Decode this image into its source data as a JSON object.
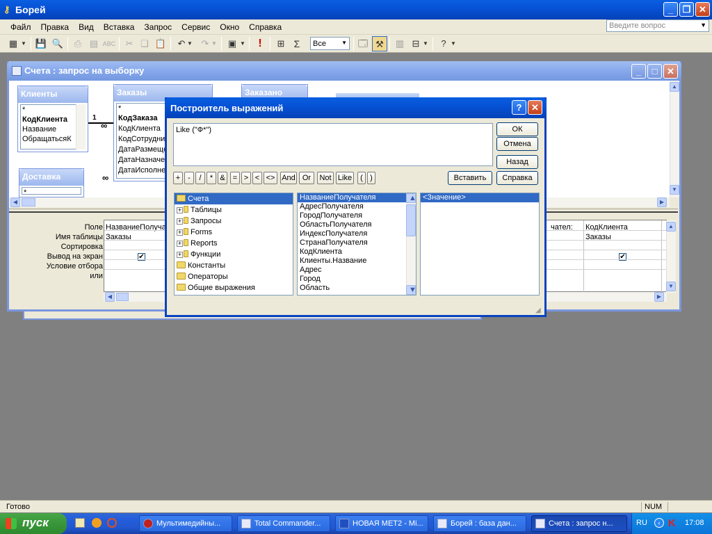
{
  "app": {
    "title": "Борей"
  },
  "menu": [
    "Файл",
    "Правка",
    "Вид",
    "Вставка",
    "Запрос",
    "Сервис",
    "Окно",
    "Справка"
  ],
  "ask_box": {
    "placeholder": "Введите вопрос"
  },
  "toolbar": {
    "top_values": "Все"
  },
  "query_window": {
    "title": "Счета : запрос на выборку",
    "tables": [
      {
        "name": "Клиенты",
        "fields": [
          "*",
          "КодКлиента",
          "Название",
          "ОбращатьсяК"
        ]
      },
      {
        "name": "Заказы",
        "fields": [
          "*",
          "КодЗаказа",
          "КодКлиента",
          "КодСотрудни",
          "ДатаРазмеще",
          "ДатаНазначе",
          "ДатаИсполнен"
        ]
      },
      {
        "name": "Заказано",
        "fields": []
      },
      {
        "name": "Доставка",
        "fields": [
          "*"
        ]
      }
    ],
    "join_one": "1",
    "join_many": "∞",
    "grid_labels": [
      "Поле:",
      "Имя таблицы:",
      "Сортировка:",
      "Вывод на экран:",
      "Условие отбора:",
      "или:"
    ],
    "col1": {
      "field": "НазваниеПолучателя",
      "table": "Заказы"
    },
    "col2": {
      "field": "чател:"
    },
    "col3": {
      "field": "КодКлиента",
      "table": "Заказы"
    }
  },
  "dialog": {
    "title": "Построитель выражений",
    "expression": "Like (\"Ф*\")",
    "buttons": {
      "ok": "ОК",
      "cancel": "Отмена",
      "undo": "Назад",
      "paste": "Вставить",
      "help": "Справка"
    },
    "operators": [
      "+",
      "-",
      "/",
      "*",
      "&",
      "=",
      ">",
      "<",
      "<>",
      "And",
      "Or",
      "Not",
      "Like",
      "(",
      ")"
    ],
    "tree": [
      {
        "label": "Счета",
        "type": "open",
        "selected": true
      },
      {
        "label": "Таблицы",
        "type": "plus"
      },
      {
        "label": "Запросы",
        "type": "plus"
      },
      {
        "label": "Forms",
        "type": "plus"
      },
      {
        "label": "Reports",
        "type": "plus"
      },
      {
        "label": "Функции",
        "type": "plus"
      },
      {
        "label": "Константы",
        "type": "folder"
      },
      {
        "label": "Операторы",
        "type": "folder"
      },
      {
        "label": "Общие выражения",
        "type": "folder"
      }
    ],
    "fields": [
      "НазваниеПолучателя",
      "АдресПолучателя",
      "ГородПолучателя",
      "ОбластьПолучателя",
      "ИндексПолучателя",
      "СтранаПолучателя",
      "КодКлиента",
      "Клиенты.Название",
      "Адрес",
      "Город",
      "Область"
    ],
    "values": [
      "<Значение>"
    ]
  },
  "status": {
    "left": "Готово",
    "num": "NUM"
  },
  "taskbar": {
    "start": "пуск",
    "tasks": [
      "Мультимедийны...",
      "Total Commander...",
      "НОВАЯ МЕТ2 - Mi...",
      "Борей : база дан...",
      "Счета : запрос н..."
    ],
    "lang": "RU",
    "clock": "17:08"
  }
}
